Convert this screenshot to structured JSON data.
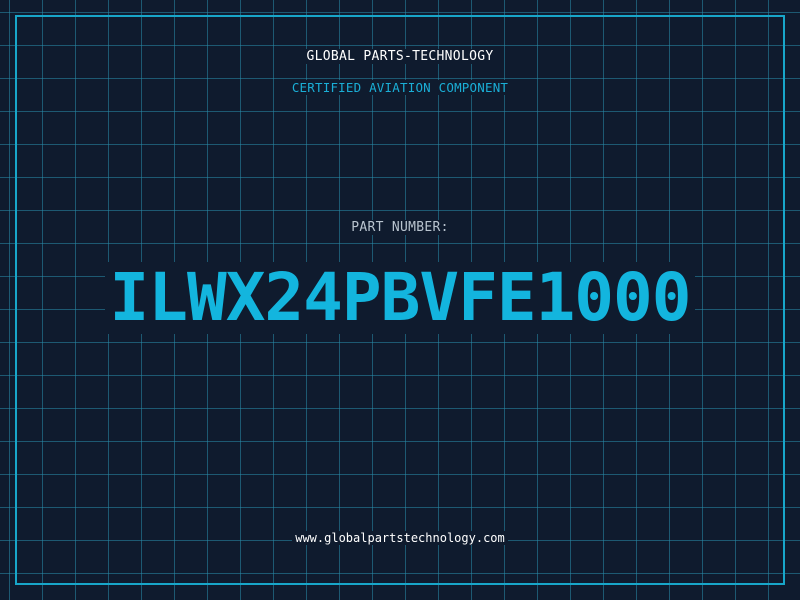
{
  "label": {
    "company": "GLOBAL PARTS-TECHNOLOGY",
    "subtitle": "CERTIFIED AVIATION COMPONENT",
    "part_label": "PART NUMBER:",
    "part_number": "ILWX24PBVFE1000",
    "website": "www.globalpartstechnology.com"
  },
  "colors": {
    "background": "#0f1b2e",
    "grid": "#288caa",
    "accent": "#13b5de",
    "border": "#18a6c9",
    "text": "#ffffff",
    "label_text": "#b9c4cf"
  }
}
